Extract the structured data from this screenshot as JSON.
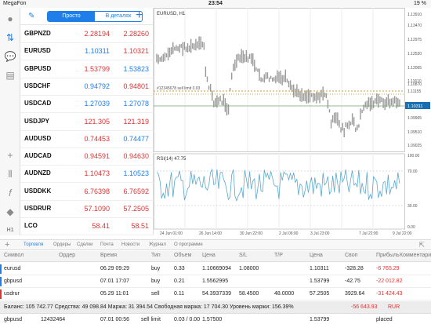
{
  "status": {
    "carrier": "MegaFon",
    "time": "23:54",
    "battery": "19 %"
  },
  "quotes": {
    "segment_simple": "Просто",
    "segment_detail": "В деталях",
    "rows": [
      {
        "symbol": "GBPNZD",
        "bid": "2.28194",
        "ask": "2.28260",
        "bid_color": "red",
        "ask_color": "red"
      },
      {
        "symbol": "EURUSD",
        "bid": "1.10311",
        "ask": "1.10321",
        "bid_color": "blue",
        "ask_color": "red"
      },
      {
        "symbol": "GBPUSD",
        "bid": "1.53799",
        "ask": "1.53823",
        "bid_color": "red",
        "ask_color": "blue"
      },
      {
        "symbol": "USDCHF",
        "bid": "0.94792",
        "ask": "0.94801",
        "bid_color": "blue",
        "ask_color": "red"
      },
      {
        "symbol": "USDCAD",
        "bid": "1.27039",
        "ask": "1.27078",
        "bid_color": "blue",
        "ask_color": "blue"
      },
      {
        "symbol": "USDJPY",
        "bid": "121.305",
        "ask": "121.319",
        "bid_color": "red",
        "ask_color": "red"
      },
      {
        "symbol": "AUDUSD",
        "bid": "0.74453",
        "ask": "0.74477",
        "bid_color": "red",
        "ask_color": "blue"
      },
      {
        "symbol": "AUDCAD",
        "bid": "0.94591",
        "ask": "0.94630",
        "bid_color": "red",
        "ask_color": "red"
      },
      {
        "symbol": "AUDNZD",
        "bid": "1.10473",
        "ask": "1.10523",
        "bid_color": "red",
        "ask_color": "blue"
      },
      {
        "symbol": "USDDKK",
        "bid": "6.76398",
        "ask": "6.76592",
        "bid_color": "red",
        "ask_color": "red"
      },
      {
        "symbol": "USDRUR",
        "bid": "57.1090",
        "ask": "57.2505",
        "bid_color": "red",
        "ask_color": "red"
      },
      {
        "symbol": "LCO",
        "bid": "58.41",
        "ask": "58.51",
        "bid_color": "red",
        "ask_color": "red"
      }
    ]
  },
  "chart": {
    "title": "EURUSD, H1",
    "indicator": "RSI(14) 47.75",
    "order_label": "#12345678 sell limit 0.03",
    "current_price": "1.10311",
    "price_ticks": [
      "1.13910",
      "1.13470",
      "1.12975",
      "1.12520",
      "1.12065",
      "1.11610",
      "1.11155",
      "1.10870",
      "1.10311",
      "1.09965",
      "1.09510",
      "1.09025"
    ],
    "rsi_ticks": [
      "100.00",
      "70.00",
      "30.00",
      "0.00"
    ],
    "time_ticks": [
      "24 Jun 01:00",
      "26 Jun 14:00",
      "30 Jun 22:00",
      "2 Jul 06:00",
      "3 Jul 23:00",
      "7 Jul 22:00",
      "9 Jul 22:00"
    ],
    "colors": {
      "candle": "#999999",
      "rsi": "#5aa8cc",
      "current": "#1a6fb0",
      "order": "#c8a040",
      "bid_line": "#6aa86a"
    }
  },
  "tabs": {
    "items": [
      "Торговля",
      "Ордеры",
      "Сделки",
      "Почта",
      "Новости",
      "Журнал",
      "О программе"
    ],
    "active": "Торговля"
  },
  "table": {
    "headers": [
      "Символ",
      "Ордер",
      "Время",
      "Тип",
      "Объем",
      "Цена",
      "S/L",
      "T/P",
      "Цена",
      "Своп",
      "Прибыль",
      "Комментарий"
    ],
    "rows": [
      {
        "symbol": "eurusd",
        "order": "",
        "time": "06.29 09:29",
        "type": "buy",
        "volume": "0.33",
        "price": "1.10669094",
        "sl": "1.08000",
        "tp": "",
        "cur": "1.10311",
        "swap": "-328.28",
        "profit": "-6 765.29",
        "comment": "",
        "color": "#1f7ee8"
      },
      {
        "symbol": "gbpusd",
        "order": "",
        "time": "07.01 17:07",
        "type": "buy",
        "volume": "0.21",
        "price": "1.5562995",
        "sl": "",
        "tp": "",
        "cur": "1.53799",
        "swap": "-42.75",
        "profit": "-22 012.82",
        "comment": "",
        "color": "#1f7ee8"
      },
      {
        "symbol": "usdrur",
        "order": "",
        "time": "05.29 11:01",
        "type": "sell",
        "volume": "0.11",
        "price": "54.3937339",
        "sl": "58.4500",
        "tp": "48.0000",
        "cur": "57.2505",
        "swap": "3929.64",
        "profit": "-31 424.43",
        "comment": "",
        "color": "#d33"
      }
    ],
    "summary": "Баланс: 105 742.77 Средства: 49 098.84 Маржа: 31 394.54 Свободная маржа: 17 704.30 Уровень маржи: 156.39%",
    "summary_profit": "-56 643.93",
    "summary_currency": "RUR",
    "pending": {
      "symbol": "gbpusd",
      "order": "12432464",
      "time": "07.01 00:56",
      "type": "sell limit",
      "volume": "0.03 / 0.00",
      "price": "1.57500",
      "cur": "1.53799",
      "profit": "placed"
    }
  }
}
